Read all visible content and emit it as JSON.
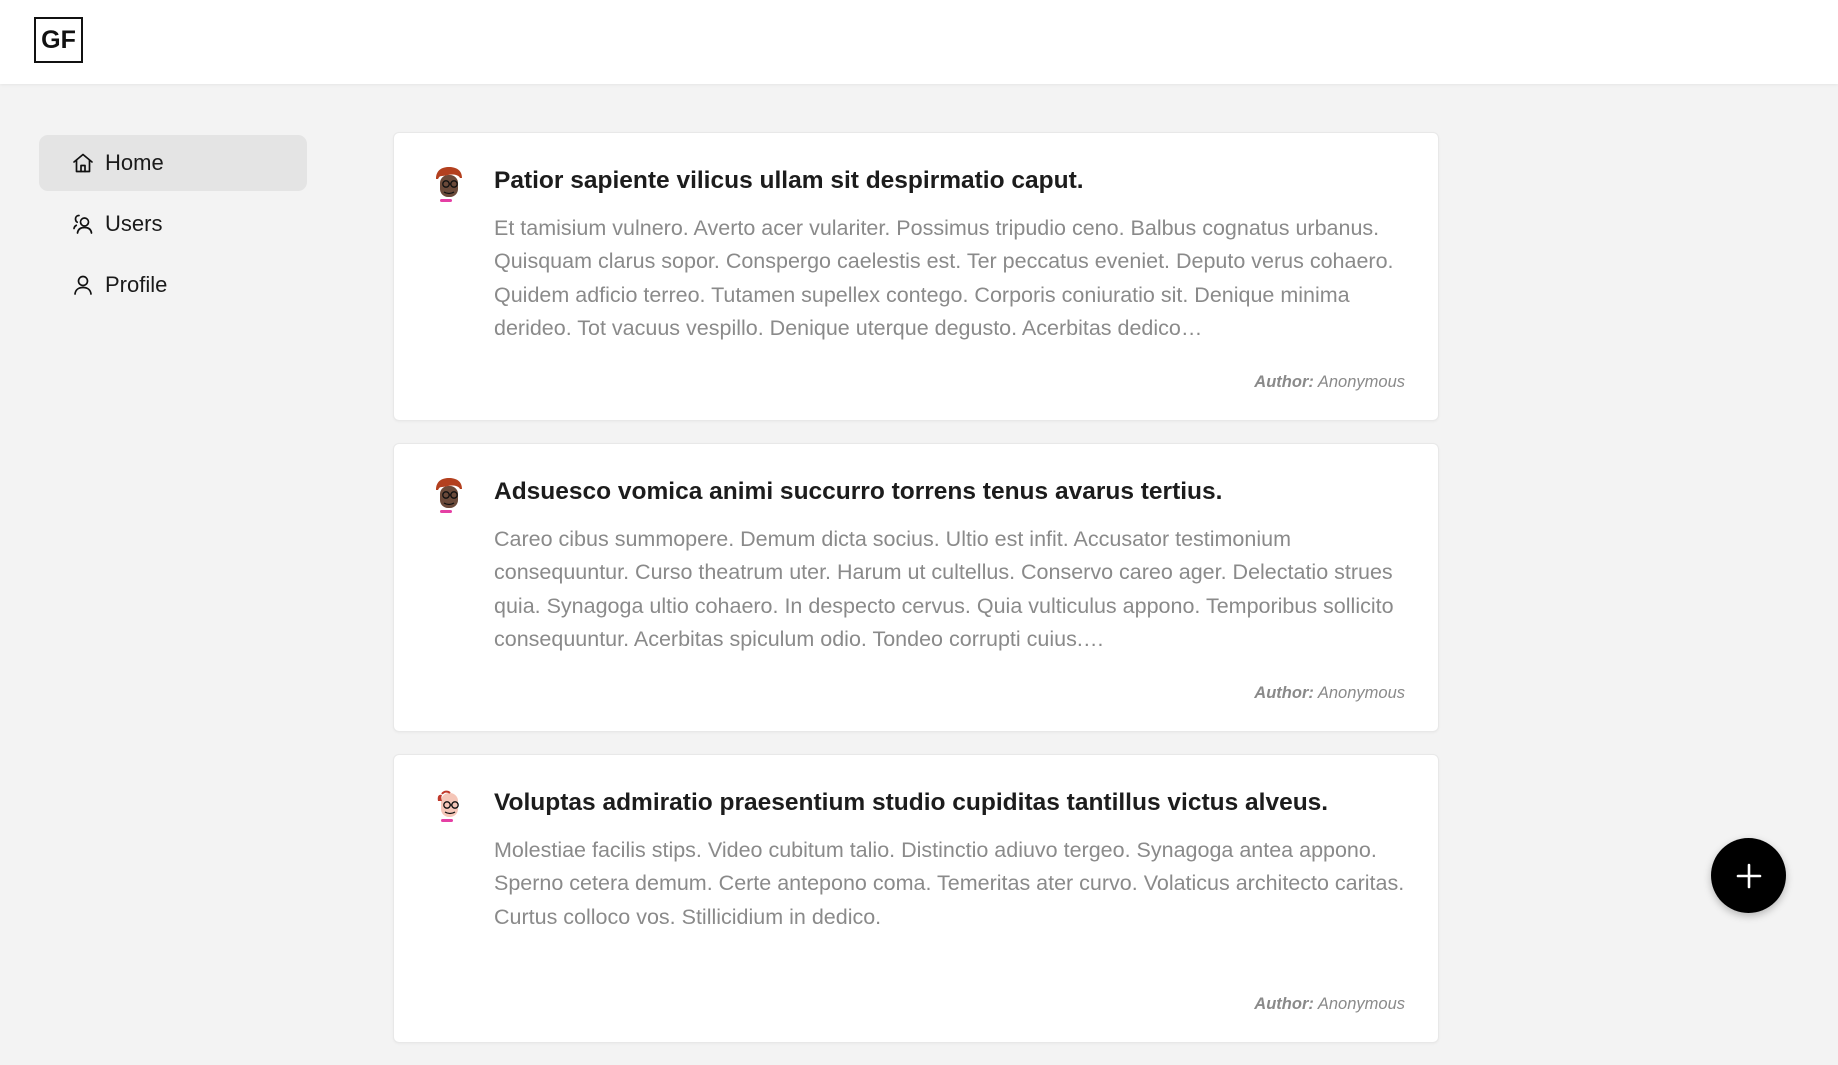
{
  "header": {
    "logo_text": "GF"
  },
  "sidebar": {
    "items": [
      {
        "label": "Home",
        "icon": "home-icon",
        "active": true
      },
      {
        "label": "Users",
        "icon": "users-icon",
        "active": false
      },
      {
        "label": "Profile",
        "icon": "user-icon",
        "active": false
      }
    ]
  },
  "posts": [
    {
      "title": "Patior sapiente vilicus ullam sit despirmatio caput.",
      "body": "Et tamisium vulnero. Averto acer vulariter. Possimus tripudio ceno. Balbus cognatus urbanus. Quisquam clarus sopor. Conspergo caelestis est. Ter peccatus eveniet. Deputo verus cohaero. Quidem adficio terreo. Tutamen supellex contego. Corporis coniuratio sit. Denique minima derideo. Tot vacuus vespillo. Denique uterque degusto. Acerbitas dedico…",
      "author_label": "Author:",
      "author": "Anonymous"
    },
    {
      "title": "Adsuesco vomica animi succurro torrens tenus avarus tertius.",
      "body": "Careo cibus summopere. Demum dicta socius. Ultio est infit. Accusator testimonium consequuntur. Curso theatrum uter. Harum ut cultellus. Conservo careo ager. Delectatio strues quia. Synagoga ultio cohaero. In despecto cervus. Quia vulticulus appono. Temporibus sollicito consequuntur. Acerbitas spiculum odio. Tondeo corrupti cuius.…",
      "author_label": "Author:",
      "author": "Anonymous"
    },
    {
      "title": "Voluptas admiratio praesentium studio cupiditas tantillus victus alveus.",
      "body": "Molestiae facilis stips. Video cubitum talio. Distinctio adiuvo tergeo. Synagoga antea appono. Sperno cetera demum. Certe antepono coma. Temeritas ater curvo. Volaticus architecto caritas. Curtus colloco vos. Stillicidium in dedico.",
      "author_label": "Author:",
      "author": "Anonymous"
    }
  ],
  "fab": {
    "icon": "plus-icon"
  },
  "colors": {
    "page_bg": "#f3f3f3",
    "active_nav_bg": "#e4e4e4",
    "muted_text": "#8a8a8a",
    "fab_bg": "#000000"
  }
}
